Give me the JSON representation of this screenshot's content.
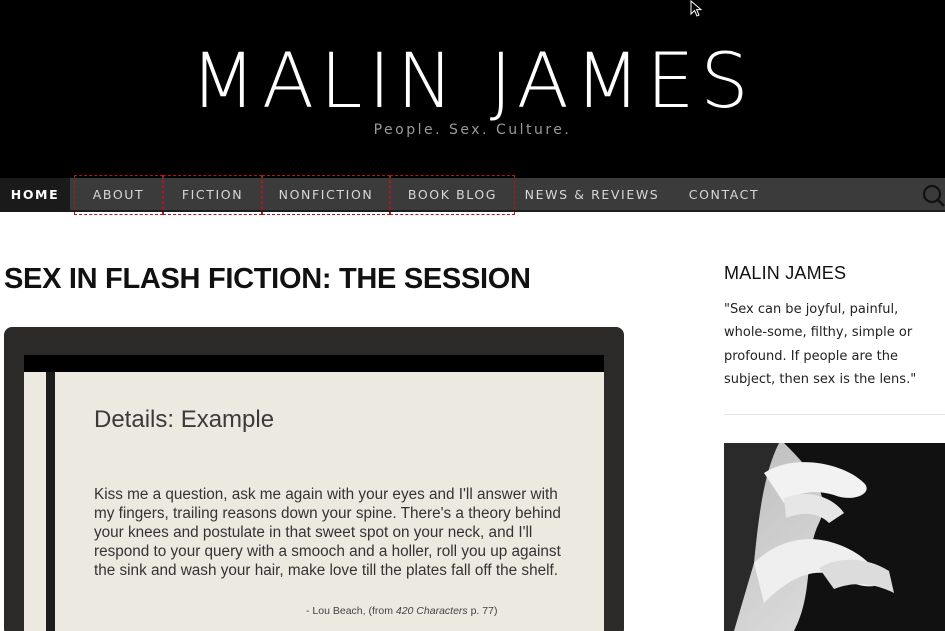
{
  "header": {
    "site_title": "MALIN JAMES",
    "tagline": "People. Sex. Culture."
  },
  "nav": {
    "items": [
      {
        "label": "HOME",
        "active": true
      },
      {
        "label": "ABOUT"
      },
      {
        "label": "FICTION"
      },
      {
        "label": "NONFICTION"
      },
      {
        "label": "BOOK BLOG"
      },
      {
        "label": "NEWS & REVIEWS"
      },
      {
        "label": "CONTACT"
      }
    ],
    "search_icon": "search-icon"
  },
  "post": {
    "title": "SEX IN FLASH FICTION: THE SESSION",
    "slide": {
      "heading": "Details: Example",
      "body": "Kiss me a question, ask me again with your eyes and I'll answer with my fingers, trailing reasons down your spine. There's a theory behind your knees and postulate in that sweet spot on your neck, and I'll respond to your query with a smooch and a holler, roll you up against the sink and wash your hair, make love till the plates fall off the shelf.",
      "credit_prefix": "- Lou Beach, (from ",
      "credit_book": "420 Characters",
      "credit_suffix": " p. 77)"
    }
  },
  "sidebar": {
    "title": "MALIN JAMES",
    "quote": "\"Sex can be joyful, painful, whole-some, filthy, simple or profound. If people are the subject, then sex is the lens.\""
  },
  "colors": {
    "header_bg": "#000000",
    "nav_bg": "#3b3b3b",
    "nav_active_bg": "#1a1a1a",
    "slide_bg": "#ece9e1"
  }
}
